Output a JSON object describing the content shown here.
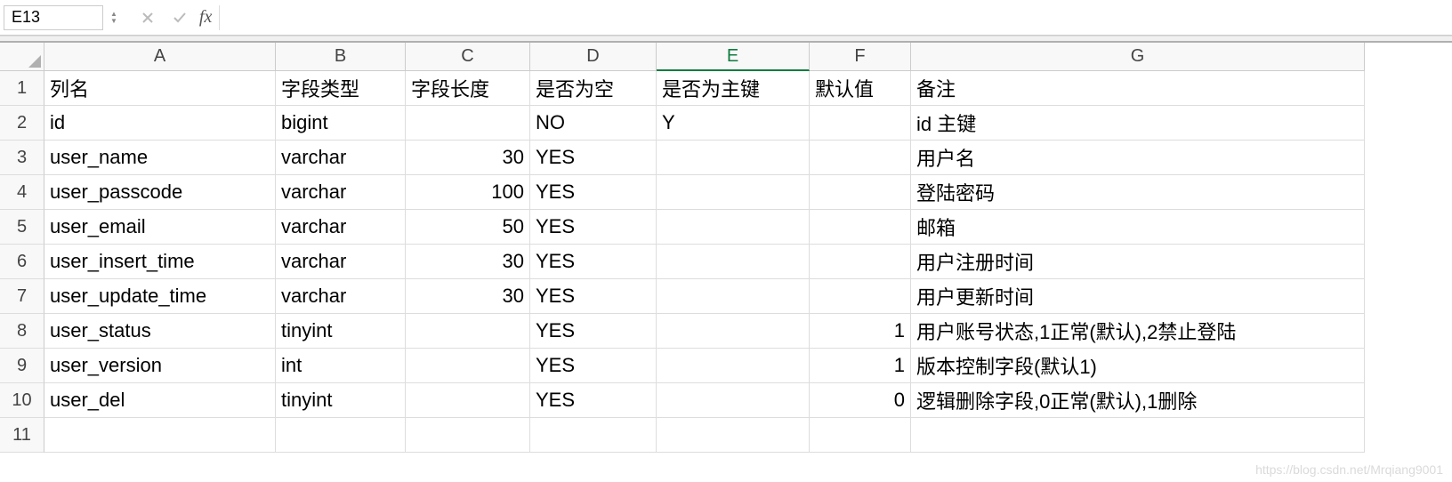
{
  "formula_bar": {
    "name_box_value": "E13",
    "fx_label": "fx",
    "formula_value": ""
  },
  "columns": [
    "A",
    "B",
    "C",
    "D",
    "E",
    "F",
    "G"
  ],
  "active_column": "E",
  "row_numbers": [
    "1",
    "2",
    "3",
    "4",
    "5",
    "6",
    "7",
    "8",
    "9",
    "10",
    "11"
  ],
  "rows": [
    {
      "A": "列名",
      "B": "字段类型",
      "C": "字段长度",
      "D": "是否为空",
      "E": "是否为主键",
      "F": "默认值",
      "G": "备注"
    },
    {
      "A": "id",
      "B": "bigint",
      "C": "",
      "D": "NO",
      "E": "Y",
      "F": "",
      "G": "id 主键"
    },
    {
      "A": "user_name",
      "B": "varchar",
      "C": "30",
      "D": "YES",
      "E": "",
      "F": "",
      "G": "用户名"
    },
    {
      "A": "user_passcode",
      "B": "varchar",
      "C": "100",
      "D": "YES",
      "E": "",
      "F": "",
      "G": "登陆密码"
    },
    {
      "A": "user_email",
      "B": "varchar",
      "C": "50",
      "D": "YES",
      "E": "",
      "F": "",
      "G": "邮箱"
    },
    {
      "A": "user_insert_time",
      "B": "varchar",
      "C": "30",
      "D": "YES",
      "E": "",
      "F": "",
      "G": "用户注册时间"
    },
    {
      "A": "user_update_time",
      "B": "varchar",
      "C": "30",
      "D": "YES",
      "E": "",
      "F": "",
      "G": "用户更新时间"
    },
    {
      "A": "user_status",
      "B": "tinyint",
      "C": "",
      "D": "YES",
      "E": "",
      "F": "1",
      "G": "用户账号状态,1正常(默认),2禁止登陆"
    },
    {
      "A": "user_version",
      "B": "int",
      "C": "",
      "D": "YES",
      "E": "",
      "F": "1",
      "G": "版本控制字段(默认1)"
    },
    {
      "A": "user_del",
      "B": "tinyint",
      "C": "",
      "D": "YES",
      "E": "",
      "F": "0",
      "G": "逻辑删除字段,0正常(默认),1删除"
    },
    {
      "A": "",
      "B": "",
      "C": "",
      "D": "",
      "E": "",
      "F": "",
      "G": ""
    }
  ],
  "numeric_columns": [
    "C",
    "F"
  ],
  "watermark": "https://blog.csdn.net/Mrqiang9001"
}
